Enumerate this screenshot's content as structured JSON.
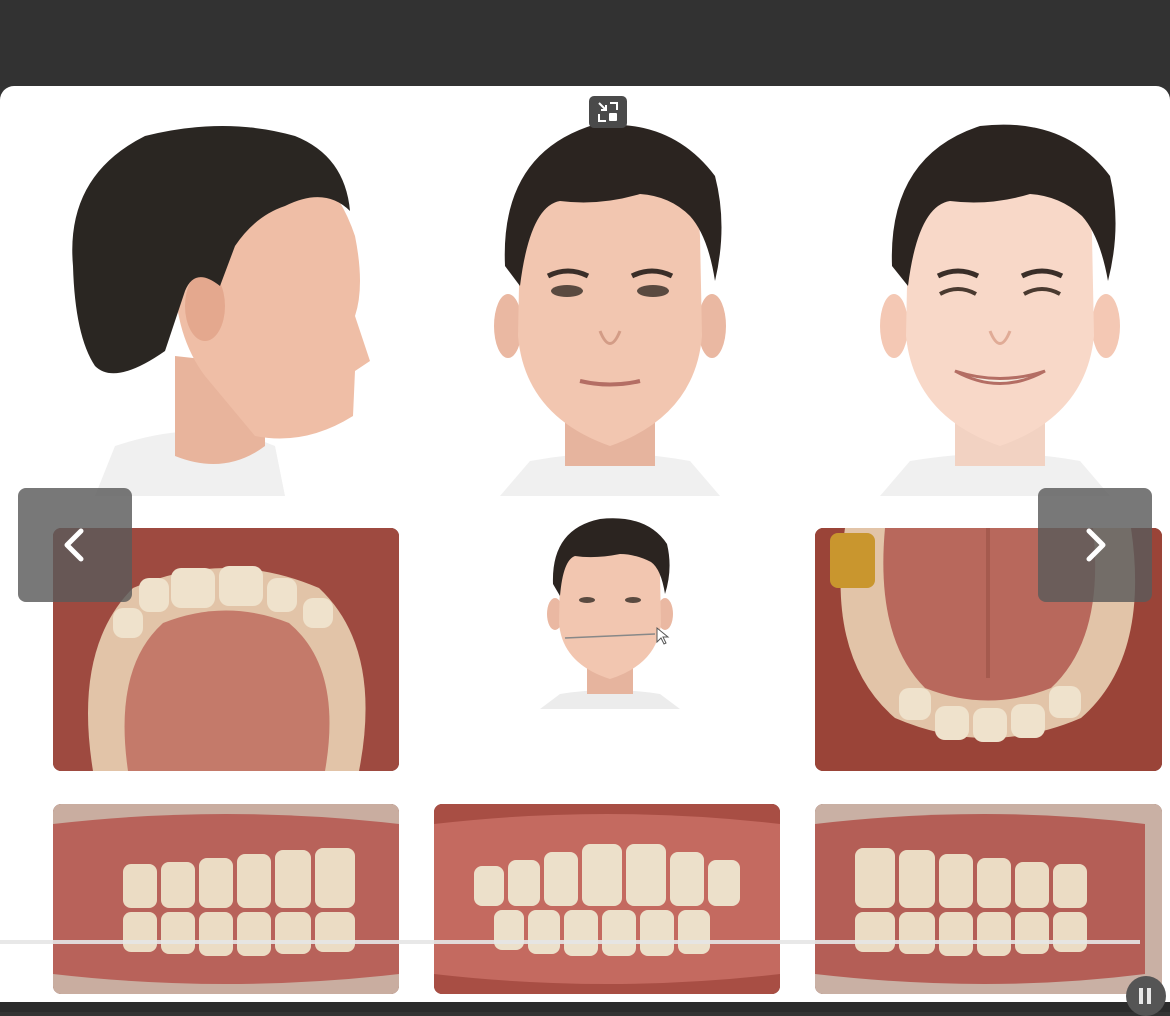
{
  "viewer": {
    "photos": {
      "extraoral": [
        "profile-photo",
        "frontal-rest-photo",
        "frontal-smile-photo"
      ],
      "center": "frontal-small-photo"
    },
    "intraoral": [
      "upper-occlusal",
      "lower-occlusal",
      "right-buccal",
      "frontal-occlusion",
      "left-buccal"
    ]
  },
  "controls": {
    "prev_icon": "chevron-left-icon",
    "next_icon": "chevron-right-icon",
    "collapse_icon": "exit-fullscreen-icon",
    "pause_icon": "pause-icon"
  },
  "colors": {
    "topbar": "#323232",
    "viewer_bg": "#ffffff",
    "nav_button": "#5a5a5a",
    "gum": "#b55a4f",
    "tooth": "#e9dcc2"
  }
}
